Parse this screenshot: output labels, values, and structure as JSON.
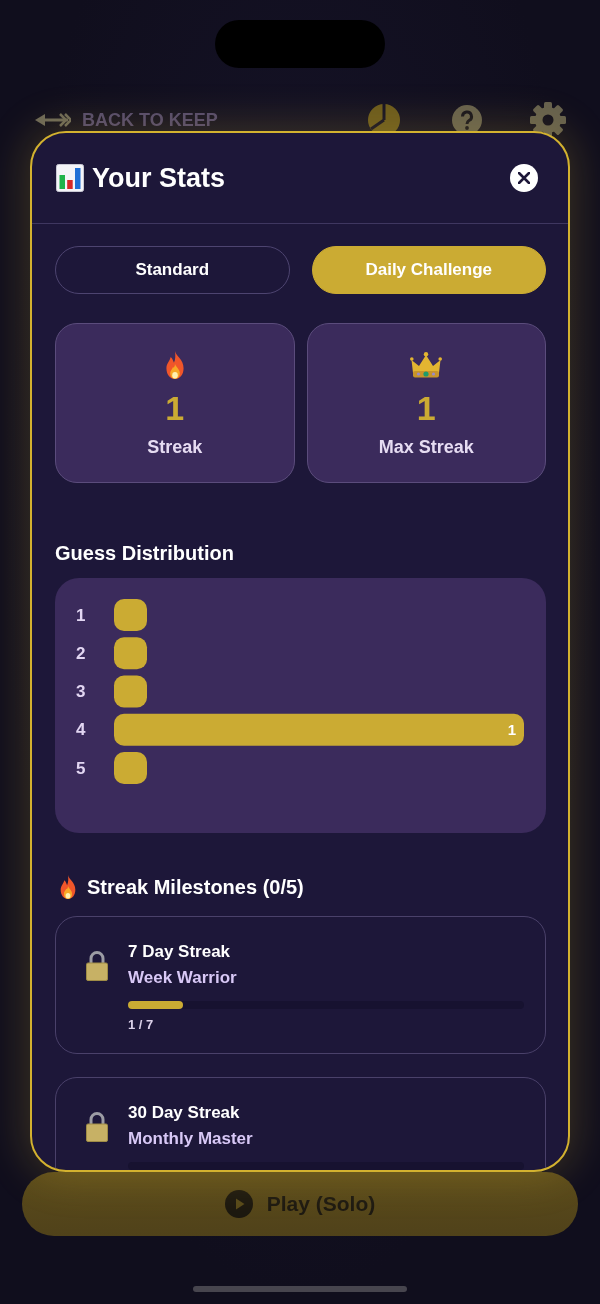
{
  "background": {
    "back_link": "BACK TO KEEP",
    "play_button": "Play (Solo)"
  },
  "modal": {
    "title": "Your Stats",
    "tabs": [
      {
        "label": "Standard",
        "selected": false
      },
      {
        "label": "Daily Challenge",
        "selected": true
      }
    ],
    "stats": [
      {
        "kind": "fire",
        "value": "1",
        "label": "Streak"
      },
      {
        "kind": "crown",
        "value": "1",
        "label": "Max Streak"
      }
    ],
    "guess_distribution": {
      "title": "Guess Distribution",
      "chart_data": {
        "type": "bar",
        "orientation": "horizontal",
        "categories": [
          "1",
          "2",
          "3",
          "4",
          "5"
        ],
        "values": [
          0,
          0,
          0,
          1,
          0
        ],
        "value_labels": [
          null,
          null,
          null,
          "1",
          null
        ]
      }
    },
    "milestones": {
      "title": "Streak Milestones (0/5)",
      "items": [
        {
          "title": "7 Day Streak",
          "subtitle": "Week Warrior",
          "locked": true,
          "level": 0.14,
          "progress": "1 / 7"
        },
        {
          "title": "30 Day Streak",
          "subtitle": "Monthly Master",
          "locked": true
        }
      ]
    }
  }
}
